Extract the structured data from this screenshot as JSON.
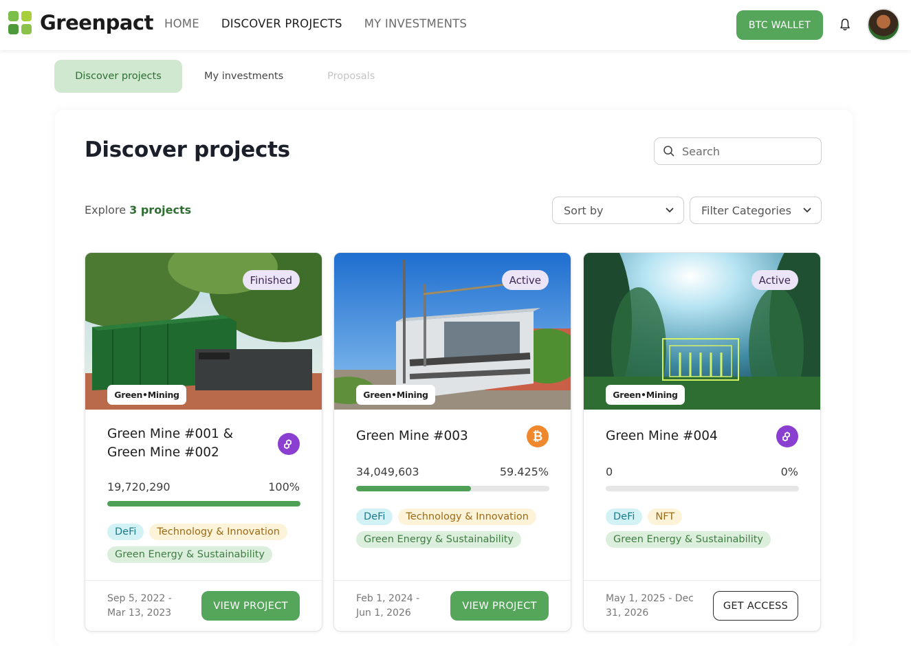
{
  "app": {
    "name": "Greenpact"
  },
  "nav": {
    "items": [
      {
        "label": "HOME",
        "active": false
      },
      {
        "label": "DISCOVER PROJECTS",
        "active": true
      },
      {
        "label": "MY INVESTMENTS",
        "active": false
      }
    ],
    "wallet_label": "BTC WALLET"
  },
  "subtabs": [
    {
      "label": "Discover projects",
      "state": "active"
    },
    {
      "label": "My investments",
      "state": "normal"
    },
    {
      "label": "Proposals",
      "state": "disabled"
    }
  ],
  "page": {
    "title": "Discover projects",
    "search_placeholder": "Search",
    "explore_prefix": "Explore",
    "explore_count": "3 projects",
    "sort_label": "Sort by",
    "filter_label": "Filter Categories"
  },
  "colors": {
    "accent": "#55a55b",
    "tab_active_bg": "#cfe8cf",
    "status_bg": "#ece4f7",
    "polygon": "#8a3fd1",
    "bitcoin": "#f0892e"
  },
  "projects": [
    {
      "status": "Finished",
      "brand": "Green•Mining",
      "title": "Green Mine #001 & Green Mine #002",
      "chain_icon": "polygon-icon",
      "amount": "19,720,290",
      "percent": "100%",
      "progress": 1.0,
      "tags": [
        "DeFi",
        "Technology & Innovation",
        "Green Energy & Sustainability"
      ],
      "dates_line1": "Sep 5, 2022 -",
      "dates_line2": "Mar 13, 2023",
      "action": "VIEW PROJECT"
    },
    {
      "status": "Active",
      "brand": "Green•Mining",
      "title": "Green Mine #003",
      "chain_icon": "bitcoin-icon",
      "amount": "34,049,603",
      "percent": "59.425%",
      "progress": 0.59425,
      "tags": [
        "DeFi",
        "Technology & Innovation",
        "Green Energy & Sustainability"
      ],
      "dates_line1": "Feb 1, 2024 -",
      "dates_line2": "Jun 1, 2026",
      "action": "VIEW PROJECT"
    },
    {
      "status": "Active",
      "brand": "Green•Mining",
      "title": "Green Mine #004",
      "chain_icon": "polygon-icon",
      "amount": "0",
      "percent": "0%",
      "progress": 0,
      "tags": [
        "DeFi",
        "NFT",
        "Green Energy & Sustainability"
      ],
      "dates_line1": "May 1, 2025 - Dec",
      "dates_line2": "31, 2026",
      "action": "GET ACCESS"
    }
  ]
}
